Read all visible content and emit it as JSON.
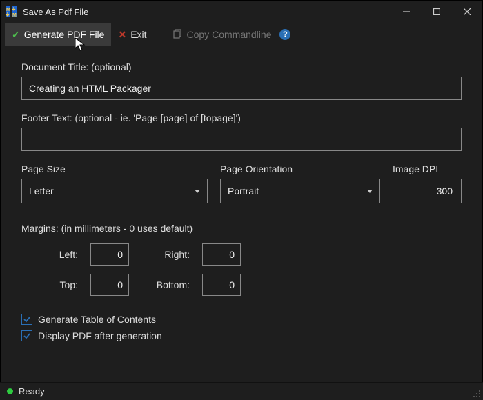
{
  "window": {
    "title": "Save As Pdf File"
  },
  "toolbar": {
    "generate": "Generate PDF File",
    "exit": "Exit",
    "copy_cmdline": "Copy Commandline"
  },
  "labels": {
    "doc_title": "Document Title: (optional)",
    "footer_text": "Footer Text: (optional - ie. 'Page [page] of [topage]')",
    "page_size": "Page Size",
    "page_orientation": "Page Orientation",
    "image_dpi": "Image DPI",
    "margins": "Margins: (in millimeters - 0 uses default)",
    "left": "Left:",
    "right": "Right:",
    "top": "Top:",
    "bottom": "Bottom:",
    "toc": "Generate Table of Contents",
    "display_after": "Display PDF after generation"
  },
  "values": {
    "doc_title": "Creating an HTML Packager",
    "footer_text": "",
    "page_size": "Letter",
    "page_orientation": "Portrait",
    "image_dpi": "300",
    "margin_left": "0",
    "margin_right": "0",
    "margin_top": "0",
    "margin_bottom": "0",
    "toc_checked": true,
    "display_after_checked": true
  },
  "status": {
    "text": "Ready"
  }
}
